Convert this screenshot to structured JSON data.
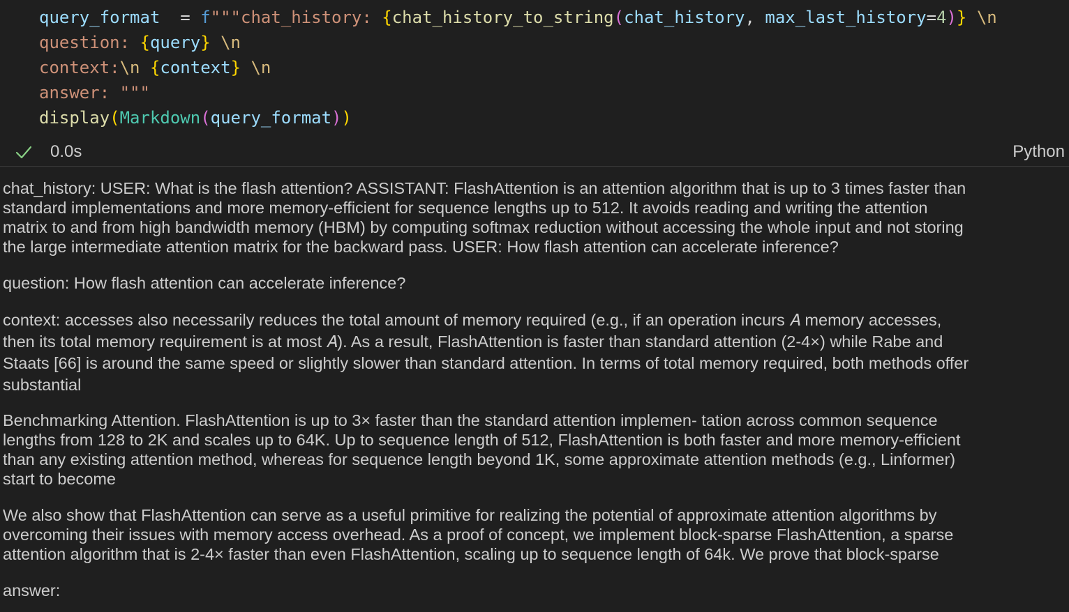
{
  "code": {
    "line1": {
      "var": "query_format",
      "assign": "  = ",
      "fprefix": "f",
      "str_open": "\"\"\"chat_history: ",
      "b1_open": "{",
      "fn": "chat_history_to_string",
      "p_open": "(",
      "arg1": "chat_history",
      "comma": ", ",
      "kw": "max_last_history",
      "eq": "=",
      "num": "4",
      "p_close": ")",
      "b1_close": "}",
      "sp": " ",
      "esc": "\\n"
    },
    "line2": {
      "str": "question: ",
      "b_open": "{",
      "var": "query",
      "b_close": "}",
      "sp": " ",
      "esc": "\\n"
    },
    "line3": {
      "str": "context:",
      "esc1": "\\n",
      "sp1": " ",
      "b_open": "{",
      "var": "context",
      "b_close": "}",
      "sp2": " ",
      "esc2": "\\n"
    },
    "line4": {
      "str": "answer: \"\"\""
    },
    "line5": {
      "fn": "display",
      "p1_open": "(",
      "cls": "Markdown",
      "p2_open": "(",
      "var": "query_format",
      "p2_close": ")",
      "p1_close": ")"
    }
  },
  "status": {
    "icon": "check-icon",
    "time": "0.0s",
    "language": "Python",
    "success_color": "#89d185"
  },
  "output": {
    "chat_history": "chat_history: USER: What is the flash attention? ASSISTANT: FlashAttention is an attention algorithm that is up to 3 times faster than\nstandard implementations and more memory-efficient for sequence lengths up to 512. It avoids reading and writing the attention\nmatrix to and from high bandwidth memory (HBM) by computing softmax reduction without accessing the whole input and not storing\nthe large intermediate attention matrix for the backward pass. USER: How flash attention can accelerate inference?",
    "question": "question: How flash attention can accelerate inference?",
    "context": "context: accesses also necessarily reduces the total amount of memory required (e.g., if an operation incurs 𝐴 memory accesses,\nthen its total memory requirement is at most 𝐴). As a result, FlashAttention is faster than standard attention (2-4×) while Rabe and\nStaats [66] is around the same speed or slightly slower than standard attention. In terms of total memory required, both methods offer\nsubstantial",
    "benchmark": "Benchmarking Attention. FlashAttention is up to 3× faster than the standard attention implemen- tation across common sequence\nlengths from 128 to 2K and scales up to 64K. Up to sequence length of 512, FlashAttention is both faster and more memory-efficient\nthan any existing attention method, whereas for sequence length beyond 1K, some approximate attention methods (e.g., Linformer)\nstart to become",
    "primitive": "We also show that FlashAttention can serve as a useful primitive for realizing the potential of approximate attention algorithms by\novercoming their issues with memory access overhead. As a proof of concept, we implement block-sparse FlashAttention, a sparse\nattention algorithm that is 2-4× faster than even FlashAttention, scaling up to sequence length of 64k. We prove that block-sparse",
    "answer": "answer:"
  }
}
